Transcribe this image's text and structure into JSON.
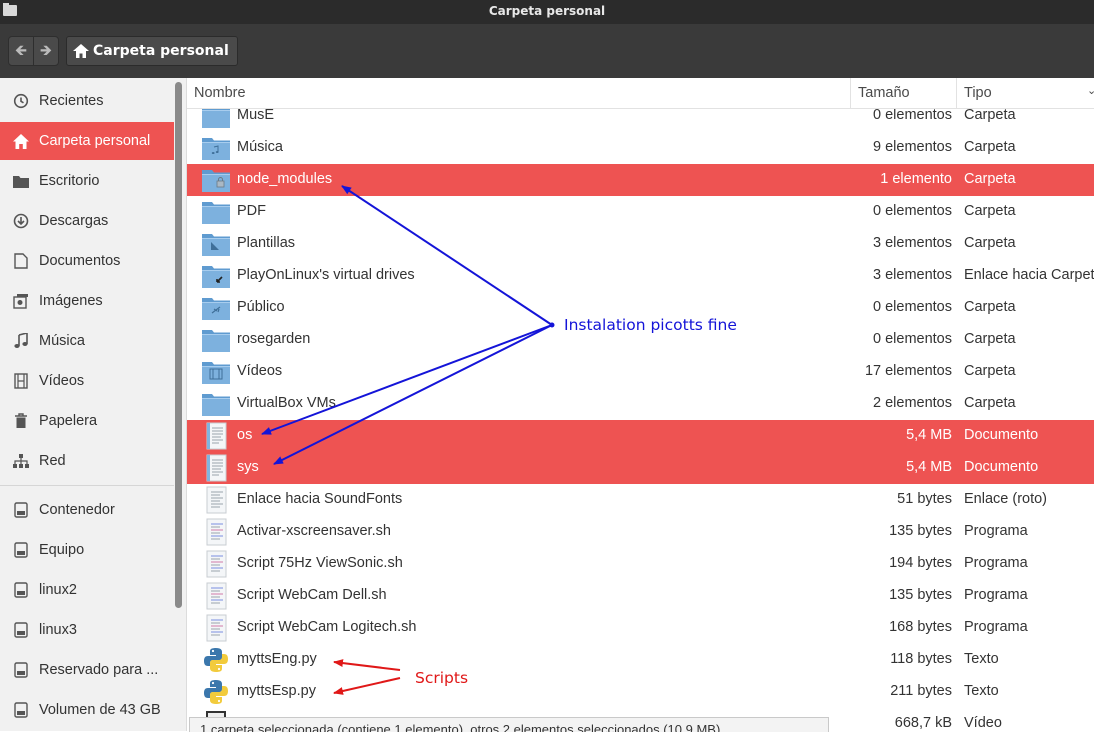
{
  "window": {
    "title": "Carpeta personal"
  },
  "header": {
    "path_label": "Carpeta personal"
  },
  "sidebar": {
    "items": [
      {
        "label": "Recientes",
        "icon": "clock-icon"
      },
      {
        "label": "Carpeta personal",
        "icon": "home-icon",
        "active": true
      },
      {
        "label": "Escritorio",
        "icon": "desktop-folder-icon"
      },
      {
        "label": "Descargas",
        "icon": "download-icon"
      },
      {
        "label": "Documentos",
        "icon": "document-icon"
      },
      {
        "label": "Imágenes",
        "icon": "camera-icon"
      },
      {
        "label": "Música",
        "icon": "music-note-icon"
      },
      {
        "label": "Vídeos",
        "icon": "film-icon"
      },
      {
        "label": "Papelera",
        "icon": "trash-icon"
      },
      {
        "label": "Red",
        "icon": "network-icon"
      }
    ],
    "devices": [
      {
        "label": "Contenedor",
        "icon": "drive-icon"
      },
      {
        "label": "Equipo",
        "icon": "drive-icon"
      },
      {
        "label": "linux2",
        "icon": "drive-icon"
      },
      {
        "label": "linux3",
        "icon": "drive-icon"
      },
      {
        "label": "Reservado para ...",
        "icon": "drive-icon"
      },
      {
        "label": "Volumen de 43 GB",
        "icon": "drive-icon"
      }
    ]
  },
  "columns": {
    "name": "Nombre",
    "size": "Tamaño",
    "type": "Tipo"
  },
  "files": [
    {
      "name": "MusE",
      "size": "0 elementos",
      "type": "Carpeta",
      "icon": "folder-icon"
    },
    {
      "name": "Música",
      "size": "9 elementos",
      "type": "Carpeta",
      "icon": "music-folder-icon"
    },
    {
      "name": "node_modules",
      "size": "1 elemento",
      "type": "Carpeta",
      "icon": "locked-folder-icon",
      "selected": true
    },
    {
      "name": "PDF",
      "size": "0 elementos",
      "type": "Carpeta",
      "icon": "folder-icon"
    },
    {
      "name": "Plantillas",
      "size": "3 elementos",
      "type": "Carpeta",
      "icon": "templates-folder-icon"
    },
    {
      "name": "PlayOnLinux's virtual drives",
      "size": "3 elementos",
      "type": "Enlace hacia Carpeta",
      "icon": "link-folder-icon"
    },
    {
      "name": "Público",
      "size": "0 elementos",
      "type": "Carpeta",
      "icon": "public-folder-icon"
    },
    {
      "name": "rosegarden",
      "size": "0 elementos",
      "type": "Carpeta",
      "icon": "folder-icon"
    },
    {
      "name": "Vídeos",
      "size": "17 elementos",
      "type": "Carpeta",
      "icon": "video-folder-icon"
    },
    {
      "name": "VirtualBox VMs",
      "size": "2 elementos",
      "type": "Carpeta",
      "icon": "folder-icon"
    },
    {
      "name": "os",
      "size": "5,4 MB",
      "type": "Documento",
      "icon": "text-document-icon",
      "selected": true
    },
    {
      "name": "sys",
      "size": "5,4 MB",
      "type": "Documento",
      "icon": "text-document-icon",
      "selected": true
    },
    {
      "name": "Enlace hacia SoundFonts",
      "size": "51 bytes",
      "type": "Enlace (roto)",
      "icon": "broken-link-icon"
    },
    {
      "name": "Activar-xscreensaver.sh",
      "size": "135 bytes",
      "type": "Programa",
      "icon": "script-icon"
    },
    {
      "name": "Script 75Hz ViewSonic.sh",
      "size": "194 bytes",
      "type": "Programa",
      "icon": "script-icon"
    },
    {
      "name": "Script WebCam Dell.sh",
      "size": "135 bytes",
      "type": "Programa",
      "icon": "script-icon"
    },
    {
      "name": "Script WebCam Logitech.sh",
      "size": "168 bytes",
      "type": "Programa",
      "icon": "script-icon"
    },
    {
      "name": "myttsEng.py",
      "size": "118 bytes",
      "type": "Texto",
      "icon": "python-icon"
    },
    {
      "name": "myttsEsp.py",
      "size": "211 bytes",
      "type": "Texto",
      "icon": "python-icon"
    },
    {
      "name": "",
      "size": "668,7 kB",
      "type": "Vídeo",
      "icon": "video-file-icon"
    }
  ],
  "statusbar": {
    "text": "1 carpeta seleccionada (contiene 1 elemento), otros 2 elementos seleccionados (10,9 MB)"
  },
  "annotations": {
    "blue_label": "Instalation picotts fine",
    "red_label": "Scripts",
    "blue_color": "#1414d8",
    "red_color": "#e01818"
  },
  "colors": {
    "accent": "#ee5352",
    "folder": "#6fa9d9"
  }
}
